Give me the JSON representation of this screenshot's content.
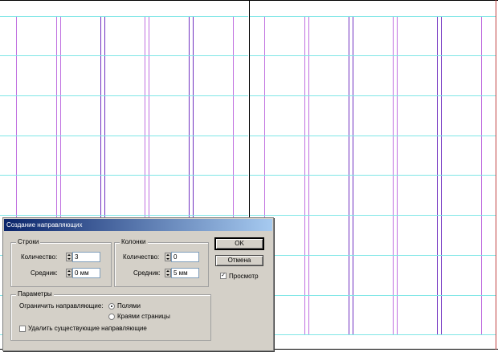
{
  "colors": {
    "horizontal_guides": "#7fe6e6",
    "vertical_guides": "#c070e0",
    "column_gutter_guides": "#7030c0",
    "dialog_bg": "#d4d0c8",
    "titlebar": "#0a246a"
  },
  "dialog": {
    "title": "Создание направляющих",
    "rows": {
      "legend": "Строки",
      "count_label": "Количество:",
      "count_value": "3",
      "gutter_label": "Средник:",
      "gutter_value": "0 мм"
    },
    "columns": {
      "legend": "Колонки",
      "count_label": "Количество:",
      "count_value": "0",
      "gutter_label": "Средник:",
      "gutter_value": "5 мм"
    },
    "ok_label": "OK",
    "cancel_label": "Отмена",
    "preview": {
      "label": "Просмотр",
      "checked": true
    },
    "options": {
      "legend": "Параметры",
      "fit_label": "Ограничить направляющие:",
      "fit_margins": "Полями",
      "fit_page": "Краями страницы",
      "fit_selected": "margins",
      "remove_label": "Удалить существующие направляющие",
      "remove_checked": false
    }
  }
}
